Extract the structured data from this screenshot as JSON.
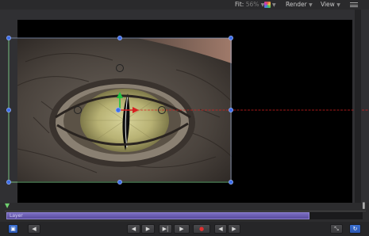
{
  "toolbar": {
    "fit_label": "Fit:",
    "fit_value": "56%",
    "render_label": "Render",
    "view_label": "View"
  },
  "timeline": {
    "clip_label": "Layer"
  },
  "transport": {
    "prev_frame": "◀",
    "go_start": "◀",
    "go_end": "▶",
    "play": "▶",
    "record": "●",
    "mark_in": "◀",
    "mark_out": "▶",
    "fullscreen": "⤡",
    "loop": "↻"
  },
  "colors": {
    "handle": "#3f6fe8",
    "x_axis": "#d62020",
    "y_axis": "#20c040",
    "clip": "#6a5db5"
  }
}
